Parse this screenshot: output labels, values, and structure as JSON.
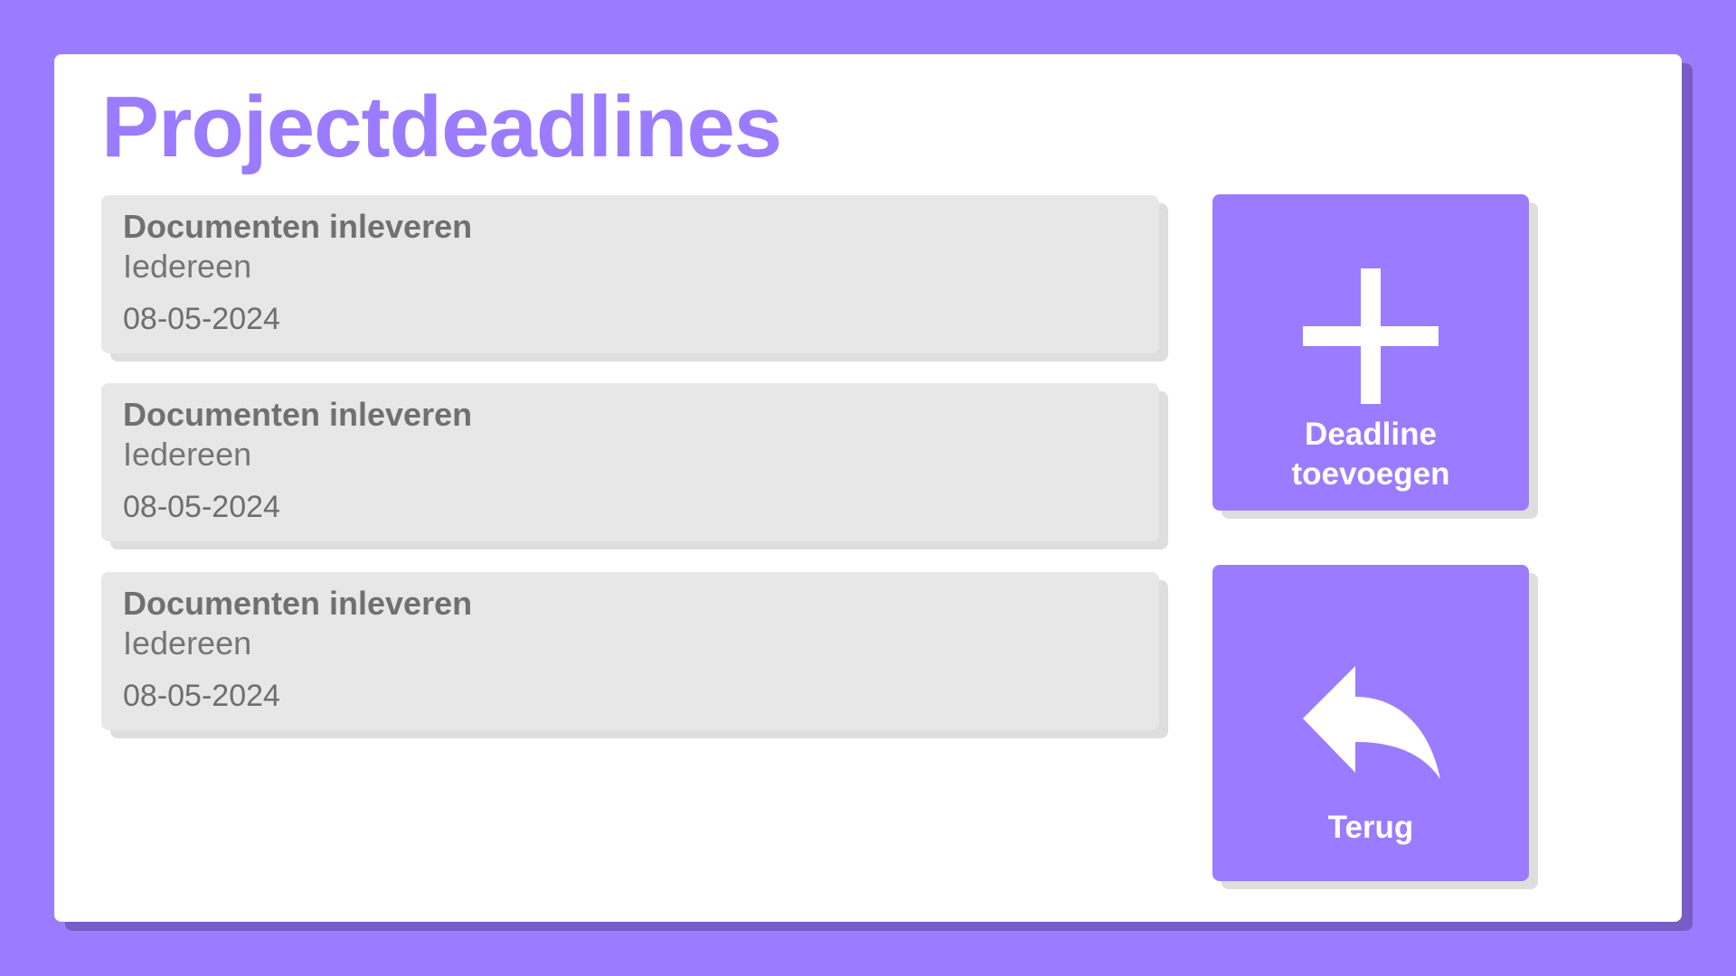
{
  "page": {
    "title": "Projectdeadlines"
  },
  "deadlines": [
    {
      "title": "Documenten inleveren",
      "assignee": "Iedereen",
      "date": "08-05-2024"
    },
    {
      "title": "Documenten inleveren",
      "assignee": "Iedereen",
      "date": "08-05-2024"
    },
    {
      "title": "Documenten inleveren",
      "assignee": "Iedereen",
      "date": "08-05-2024"
    }
  ],
  "actions": {
    "add_deadline": {
      "label": "Deadline toevoegen",
      "icon": "plus-icon"
    },
    "back": {
      "label": "Terug",
      "icon": "back-arrow-icon"
    }
  },
  "colors": {
    "accent": "#9b7bff",
    "card_background": "#e7e7e7",
    "text_gray": "#707070",
    "panel_background": "#ffffff"
  }
}
